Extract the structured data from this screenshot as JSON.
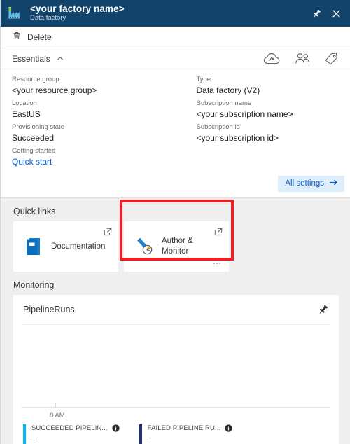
{
  "titlebar": {
    "icon": "factory-icon",
    "title": "<your factory name>",
    "subtitle": "Data factory",
    "pin_icon": "pin-icon",
    "close_icon": "close-icon"
  },
  "commandbar": {
    "delete_label": "Delete",
    "delete_icon": "trash-icon"
  },
  "essentials": {
    "header_label": "Essentials",
    "collapse_icon": "chevron-up-icon",
    "icons": [
      "cloud-icon",
      "users-icon",
      "tag-icon"
    ],
    "left_fields": [
      {
        "label": "Resource group",
        "value": "<your resource group>",
        "is_link": false
      },
      {
        "label": "Location",
        "value": "EastUS",
        "is_link": false
      },
      {
        "label": "Provisioning state",
        "value": "Succeeded",
        "is_link": false
      },
      {
        "label": "Getting started",
        "value": "Quick start",
        "is_link": true
      }
    ],
    "right_fields": [
      {
        "label": "Type",
        "value": "Data factory (V2)"
      },
      {
        "label": "Subscription name",
        "value": "<your subscription name>"
      },
      {
        "label": "Subscription id",
        "value": "<your subscription id>"
      }
    ],
    "all_settings_label": "All settings",
    "all_settings_icon": "arrow-right-icon"
  },
  "quick_links": {
    "section_title": "Quick links",
    "tiles": [
      {
        "label": "Documentation",
        "icon": "book-icon",
        "external_icon": "external-link-icon",
        "has_ellipsis": false,
        "highlighted": false
      },
      {
        "label": "Author & Monitor",
        "icon": "pencil-gauge-icon",
        "external_icon": "external-link-icon",
        "ellipsis": "...",
        "has_ellipsis": true,
        "highlighted": true
      }
    ],
    "highlight_color": "#ed2024"
  },
  "monitoring": {
    "section_title": "Monitoring",
    "card_title": "PipelineRuns",
    "pin_icon": "pin-icon",
    "chart_data": {
      "type": "line",
      "title": "PipelineRuns",
      "xlabel": "",
      "ylabel": "",
      "grid": false,
      "x_tick_labels": [
        "8 AM"
      ],
      "series": [
        {
          "name": "SUCCEEDED PIPELIN...",
          "color": "#00bcf2",
          "values": [],
          "display_value": "-"
        },
        {
          "name": "FAILED PIPELINE RU...",
          "color": "#1b2f72",
          "values": [],
          "display_value": "-"
        }
      ],
      "legend_position": "bottom",
      "note": "No data plotted; empty chart area with axis baseline only"
    },
    "legend": [
      {
        "name": "SUCCEEDED PIPELIN...",
        "color": "#00bcf2",
        "value": "-",
        "info_icon": "info-icon"
      },
      {
        "name": "FAILED PIPELINE RU...",
        "color": "#1b2f72",
        "value": "-",
        "info_icon": "info-icon"
      }
    ]
  },
  "colors": {
    "titlebar_bg": "#12436b",
    "page_bg": "#efefef",
    "card_bg": "#ffffff",
    "link": "#015cda",
    "accent_blue": "#0078d4",
    "highlight_red": "#ed2024"
  }
}
